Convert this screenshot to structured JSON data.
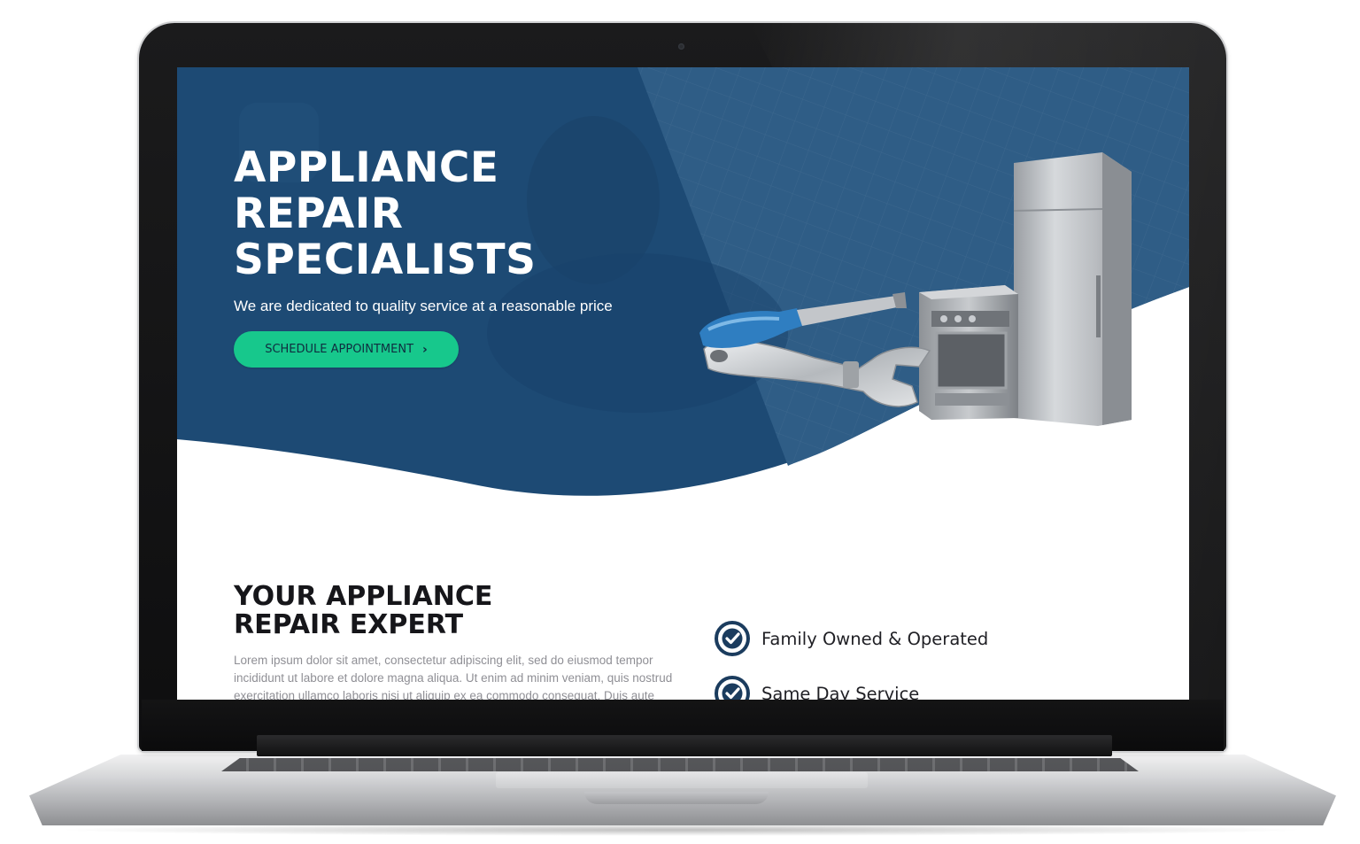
{
  "hero": {
    "title_lines": [
      "APPLIANCE",
      "REPAIR",
      "SPECIALISTS"
    ],
    "subtitle": "We are dedicated to quality service at a reasonable price",
    "cta_label": "SCHEDULE APPOINTMENT",
    "cta_icon": "chevron-right-icon",
    "illustration": [
      "screwdriver",
      "adjustable-wrench",
      "stove",
      "refrigerator"
    ]
  },
  "about": {
    "title_lines": [
      "YOUR APPLIANCE",
      "REPAIR EXPERT"
    ],
    "body": "Lorem ipsum dolor sit amet, consectetur adipiscing elit, sed do eiusmod tempor incididunt ut labore et dolore magna aliqua. Ut enim ad minim veniam, quis nostrud exercitation ullamco laboris nisi ut aliquip ex ea commodo consequat. Duis aute",
    "features": [
      {
        "label": "Family Owned & Operated",
        "icon": "check-circle-icon"
      },
      {
        "label": "Same Day Service",
        "icon": "check-circle-icon"
      }
    ]
  },
  "colors": {
    "hero_blue": "#1d4a74",
    "hero_blue_light": "#2f5d86",
    "accent_green": "#17c88c",
    "check_navy": "#1b3c5e"
  }
}
